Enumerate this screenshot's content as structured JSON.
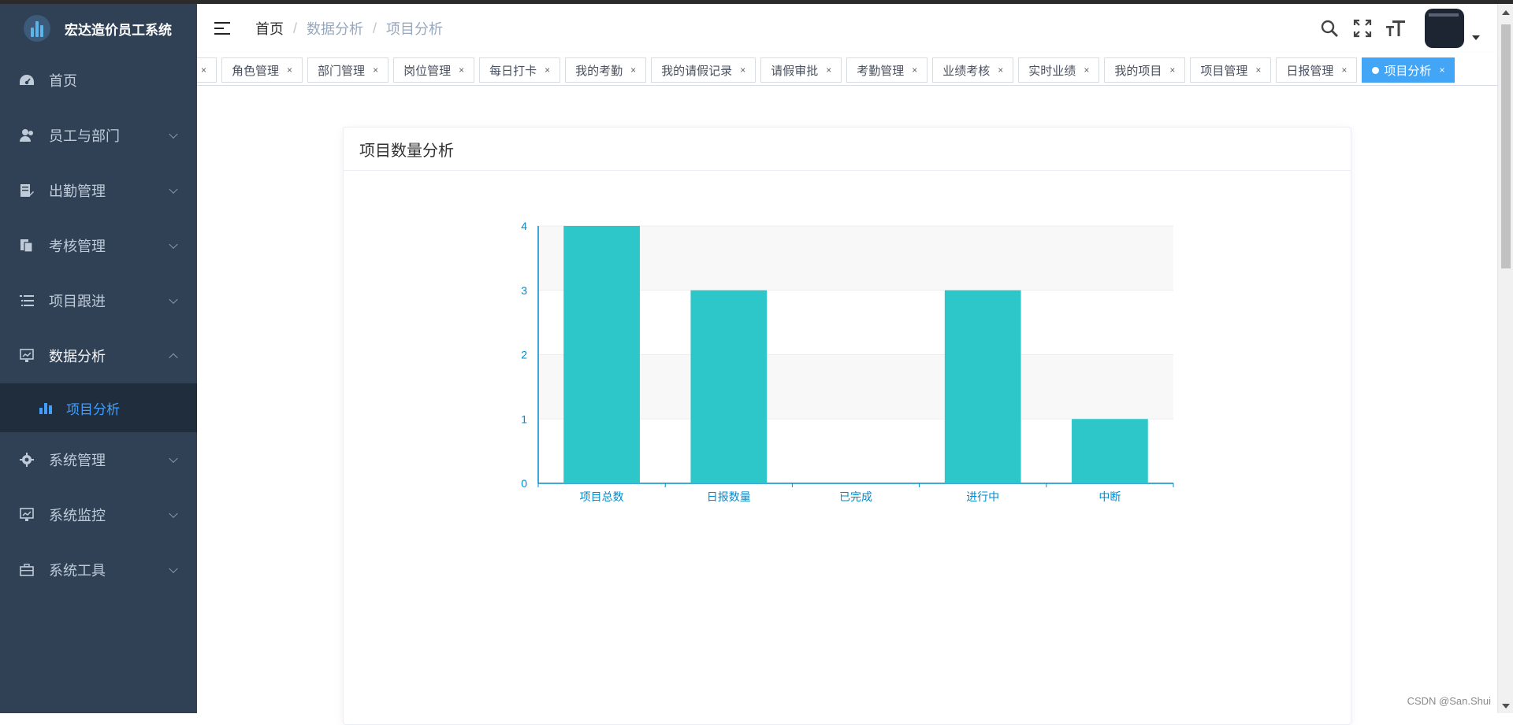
{
  "sidebar": {
    "app_title": "宏达造价员工系统",
    "items": [
      {
        "label": "首页",
        "icon": "dashboard-icon"
      },
      {
        "label": "员工与部门",
        "icon": "users-icon"
      },
      {
        "label": "出勤管理",
        "icon": "edit-doc-icon"
      },
      {
        "label": "考核管理",
        "icon": "copy-doc-icon"
      },
      {
        "label": "项目跟进",
        "icon": "list-icon"
      },
      {
        "label": "数据分析",
        "icon": "monitor-chart-icon"
      },
      {
        "label": "系统管理",
        "icon": "gear-icon"
      },
      {
        "label": "系统监控",
        "icon": "monitor-icon"
      },
      {
        "label": "系统工具",
        "icon": "toolbox-icon"
      }
    ],
    "submenu": {
      "label": "项目分析",
      "icon": "bar-chart-icon"
    }
  },
  "navbar": {
    "breadcrumb": [
      "首页",
      "数据分析",
      "项目分析"
    ],
    "separator": "/"
  },
  "tags": {
    "items": [
      "角色管理",
      "部门管理",
      "岗位管理",
      "每日打卡",
      "我的考勤",
      "我的请假记录",
      "请假审批",
      "考勤管理",
      "业绩考核",
      "实时业绩",
      "我的项目",
      "项目管理",
      "日报管理"
    ],
    "active": "项目分析",
    "close_glyph": "×"
  },
  "card": {
    "title": "项目数量分析"
  },
  "chart_data": {
    "type": "bar",
    "title": "",
    "categories": [
      "项目总数",
      "日报数量",
      "已完成",
      "进行中",
      "中断"
    ],
    "values": [
      4,
      3,
      0,
      3,
      1
    ],
    "ylim": [
      0,
      4
    ],
    "yticks": [
      0,
      1,
      2,
      3,
      4
    ],
    "xlabel": "",
    "ylabel": "",
    "bar_color": "#2ec7c9",
    "axis_color": "#008acd",
    "legend": "none"
  },
  "colors": {
    "sidebar_bg": "#304156",
    "submenu_bg": "#1f2d3d",
    "accent": "#409eff",
    "active_tag": "#42a5f5"
  },
  "watermark": "CSDN @San.Shui"
}
